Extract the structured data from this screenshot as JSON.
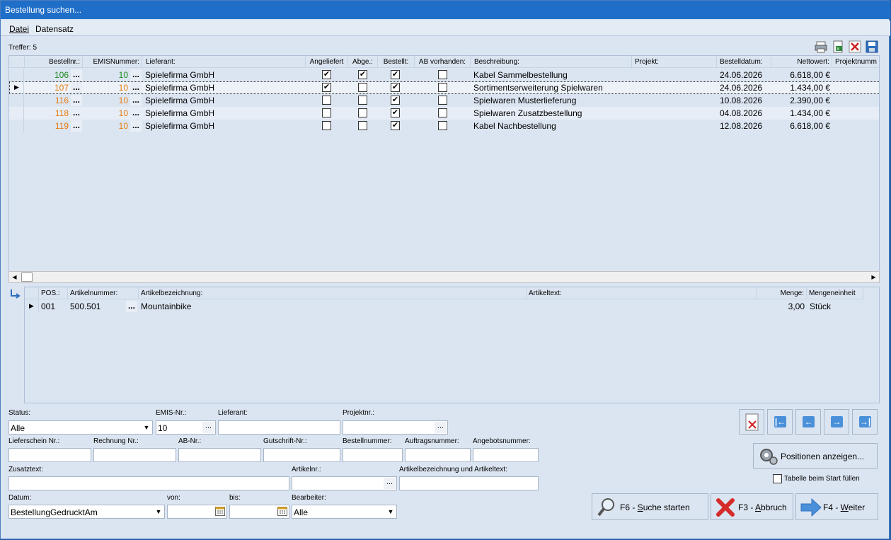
{
  "window": {
    "title": "Bestellung suchen..."
  },
  "menu": {
    "items": [
      {
        "label": "Datei"
      },
      {
        "label": "Datensatz"
      }
    ]
  },
  "result": {
    "count_label": "Treffer: 5"
  },
  "grid": {
    "headers": {
      "bestellnr": "Bestellnr.:",
      "emis": "EMISNummer:",
      "lieferant": "Lieferant:",
      "angeliefert": "Angeliefert",
      "abge": "Abge.:",
      "bestellt": "Bestellt:",
      "ab": "AB vorhanden:",
      "beschreibung": "Beschreibung:",
      "projekt": "Projekt:",
      "datum": "Bestelldatum:",
      "netto": "Nettowert:",
      "projektnr": "Projektnumm"
    },
    "rows": [
      {
        "nr": "106",
        "emis": "10",
        "lieferant": "Spielefirma GmbH",
        "angeliefert": "✔",
        "abge": "✔",
        "bestellt": "✔",
        "ab": "",
        "beschreibung": "Kabel Sammelbestellung",
        "projekt": "",
        "datum": "24.06.2026",
        "netto": "6.618,00 €",
        "color": "#1a8a1a"
      },
      {
        "nr": "107",
        "emis": "10",
        "lieferant": "Spielefirma GmbH",
        "angeliefert": "✔",
        "abge": "",
        "bestellt": "✔",
        "ab": "",
        "beschreibung": "Sortimentserweiterung Spielwaren",
        "projekt": "",
        "datum": "24.06.2026",
        "netto": "1.434,00 €",
        "color": "#e87b0c"
      },
      {
        "nr": "116",
        "emis": "10",
        "lieferant": "Spielefirma GmbH",
        "angeliefert": "",
        "abge": "",
        "bestellt": "✔",
        "ab": "",
        "beschreibung": "Spielwaren Musterlieferung",
        "projekt": "",
        "datum": "10.08.2026",
        "netto": "2.390,00 €",
        "color": "#e87b0c"
      },
      {
        "nr": "118",
        "emis": "10",
        "lieferant": "Spielefirma GmbH",
        "angeliefert": "",
        "abge": "",
        "bestellt": "✔",
        "ab": "",
        "beschreibung": "Spielwaren Zusatzbestellung",
        "projekt": "",
        "datum": "04.08.2026",
        "netto": "1.434,00 €",
        "color": "#e87b0c"
      },
      {
        "nr": "119",
        "emis": "10",
        "lieferant": "Spielefirma GmbH",
        "angeliefert": "",
        "abge": "",
        "bestellt": "✔",
        "ab": "",
        "beschreibung": "Kabel Nachbestellung",
        "projekt": "",
        "datum": "12.08.2026",
        "netto": "6.618,00 €",
        "color": "#e87b0c"
      }
    ]
  },
  "positions": {
    "headers": {
      "pos": "POS.:",
      "artnr": "Artikelnummer:",
      "bez": "Artikelbezeichnung:",
      "text": "Artikeltext:",
      "menge": "Menge:",
      "einheit": "Mengeneinheit"
    },
    "rows": [
      {
        "pos": "001",
        "artnr": "500.501",
        "bez": "Mountainbike",
        "text": "",
        "menge": "3,00",
        "einheit": "Stück"
      }
    ]
  },
  "filters": {
    "status": {
      "label": "Status:",
      "value": "Alle"
    },
    "emis": {
      "label": "EMIS-Nr.:",
      "value": "10"
    },
    "lieferant": {
      "label": "Lieferant:",
      "value": ""
    },
    "projektnr": {
      "label": "Projektnr.:",
      "value": ""
    },
    "lieferschein": {
      "label": "Lieferschein Nr.:",
      "value": ""
    },
    "rechnung": {
      "label": "Rechnung Nr.:",
      "value": ""
    },
    "ab": {
      "label": "AB-Nr.:",
      "value": ""
    },
    "gutschrift": {
      "label": "Gutschrift-Nr.:",
      "value": ""
    },
    "bestellnummer": {
      "label": "Bestellnummer:",
      "value": ""
    },
    "auftrag": {
      "label": "Auftragsnummer:",
      "value": ""
    },
    "angebot": {
      "label": "Angebotsnummer:",
      "value": ""
    },
    "zusatz": {
      "label": "Zusatztext:",
      "value": ""
    },
    "artikelnr": {
      "label": "Artikelnr.:",
      "value": ""
    },
    "artbez": {
      "label": "Artikelbezeichnung und Artikeltext:",
      "value": ""
    },
    "datum": {
      "label": "Datum:",
      "value": "BestellungGedrucktAm"
    },
    "von": {
      "label": "von:",
      "value": ""
    },
    "bis": {
      "label": "bis:",
      "value": ""
    },
    "bearbeiter": {
      "label": "Bearbeiter:",
      "value": "Alle"
    }
  },
  "buttons": {
    "positionen": "Positionen anzeigen...",
    "tabelle_fuellen": "Tabelle beim Start füllen",
    "suche_prefix": "F6 - ",
    "suche_hotkey": "S",
    "suche_rest": "uche starten",
    "abbruch_prefix": "F3 - ",
    "abbruch_hotkey": "A",
    "abbruch_rest": "bbruch",
    "weiter_prefix": "F4 - ",
    "weiter_hotkey": "W",
    "weiter_rest": "eiter"
  }
}
